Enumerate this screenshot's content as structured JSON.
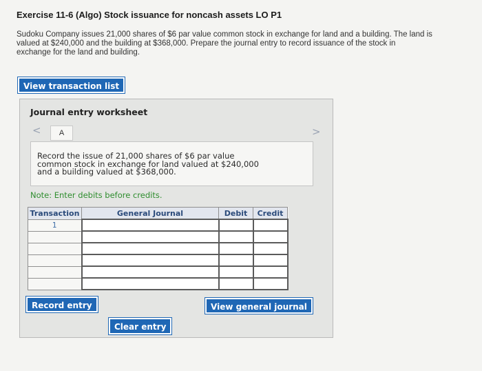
{
  "exercise": {
    "title": "Exercise 11-6 (Algo) Stock issuance for noncash assets LO P1",
    "problem_line1": "Sudoku Company issues 21,000 shares of $6 par value common stock in exchange for land and a building. The land is",
    "problem_line2": "valued at $240,000 and the building at $368,000. Prepare the journal entry to record issuance of the stock in",
    "problem_line3": "exchange for the land and building."
  },
  "buttons": {
    "view_transaction_list": "View transaction list",
    "record_entry": "Record entry",
    "view_general_journal": "View general journal",
    "clear_entry": "Clear entry"
  },
  "worksheet": {
    "title": "Journal entry worksheet",
    "prev_glyph": "<",
    "next_glyph": ">",
    "active_tab": "A",
    "instruction_line1": "Record the issue of 21,000 shares of $6 par value",
    "instruction_line2": "common stock in exchange for land valued at $240,000",
    "instruction_line3": "and a building valued at $368,000.",
    "note": "Note: Enter debits before credits."
  },
  "journal_table": {
    "headers": [
      "Transaction",
      "General Journal",
      "Debit",
      "Credit"
    ],
    "rows": [
      {
        "transaction": "1",
        "account": "",
        "debit": "",
        "credit": ""
      },
      {
        "transaction": "",
        "account": "",
        "debit": "",
        "credit": ""
      },
      {
        "transaction": "",
        "account": "",
        "debit": "",
        "credit": ""
      },
      {
        "transaction": "",
        "account": "",
        "debit": "",
        "credit": ""
      },
      {
        "transaction": "",
        "account": "",
        "debit": "",
        "credit": ""
      },
      {
        "transaction": "",
        "account": "",
        "debit": "",
        "credit": ""
      }
    ]
  },
  "colors": {
    "accent_blue": "#1f67b5",
    "note_green": "#2e8d2e",
    "header_text": "#2a4a7a"
  }
}
